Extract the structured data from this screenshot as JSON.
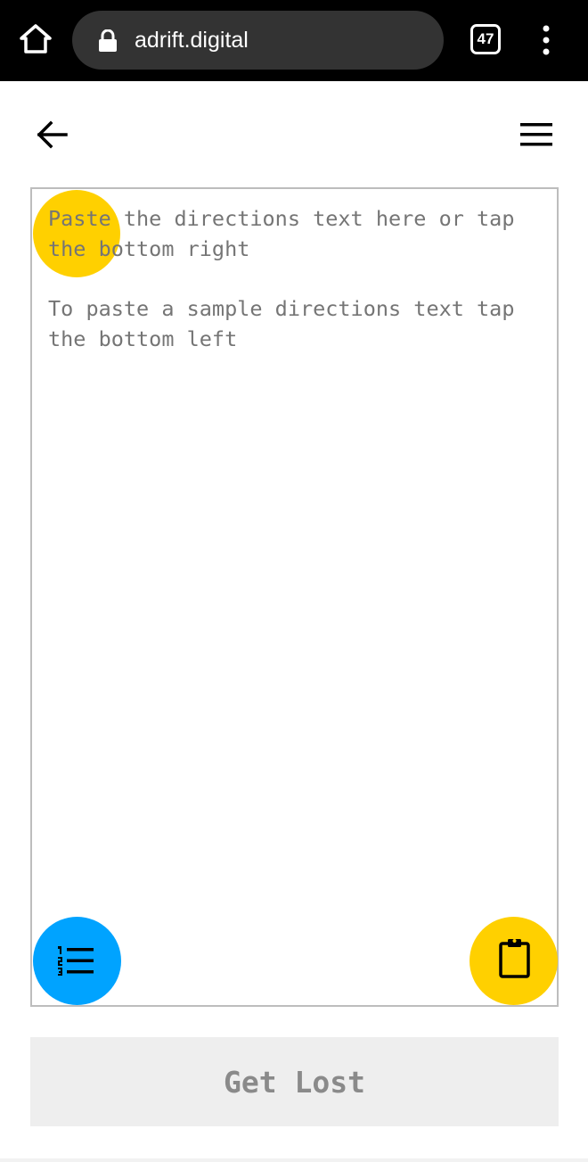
{
  "browser": {
    "url": "adrift.digital",
    "tab_count": "47",
    "icons": [
      "home-icon",
      "lock-icon",
      "tabs-icon",
      "more-vert-icon"
    ]
  },
  "header": {
    "icons": [
      "arrow-back-icon",
      "hamburger-menu-icon"
    ]
  },
  "editor": {
    "hint_line1": "Paste the directions text here or tap the bottom right",
    "hint_line2": "To paste a sample directions text tap the bottom left",
    "sample_button_icon": "numbered-list-icon",
    "paste_button_icon": "clipboard-icon"
  },
  "action": {
    "get_lost_label": "Get Lost"
  },
  "colors": {
    "browser_bar": "#000000",
    "url_pill": "#333333",
    "accent_yellow": "#ffd000",
    "accent_blue": "#00a3ff",
    "hint_text": "#757575",
    "button_bg": "#eeeeee",
    "button_text": "#8a8a8a"
  }
}
